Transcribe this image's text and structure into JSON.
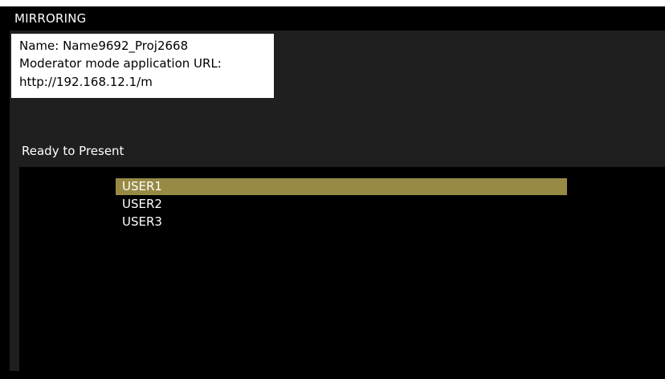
{
  "header": {
    "title": "MIRRORING"
  },
  "info": {
    "name_line": "Name: Name9692_Proj2668",
    "url_label": "Moderator mode application URL:",
    "url_value": "http://192.168.12.1/m"
  },
  "status": {
    "text": "Ready to Present"
  },
  "user_list": {
    "items": [
      {
        "label": "USER1",
        "selected": true
      },
      {
        "label": "USER2",
        "selected": false
      },
      {
        "label": "USER3",
        "selected": false
      }
    ]
  },
  "colors": {
    "background": "#000000",
    "content_background": "#1f1f1f",
    "info_box": "#ffffff",
    "selection_highlight": "#978a45"
  }
}
